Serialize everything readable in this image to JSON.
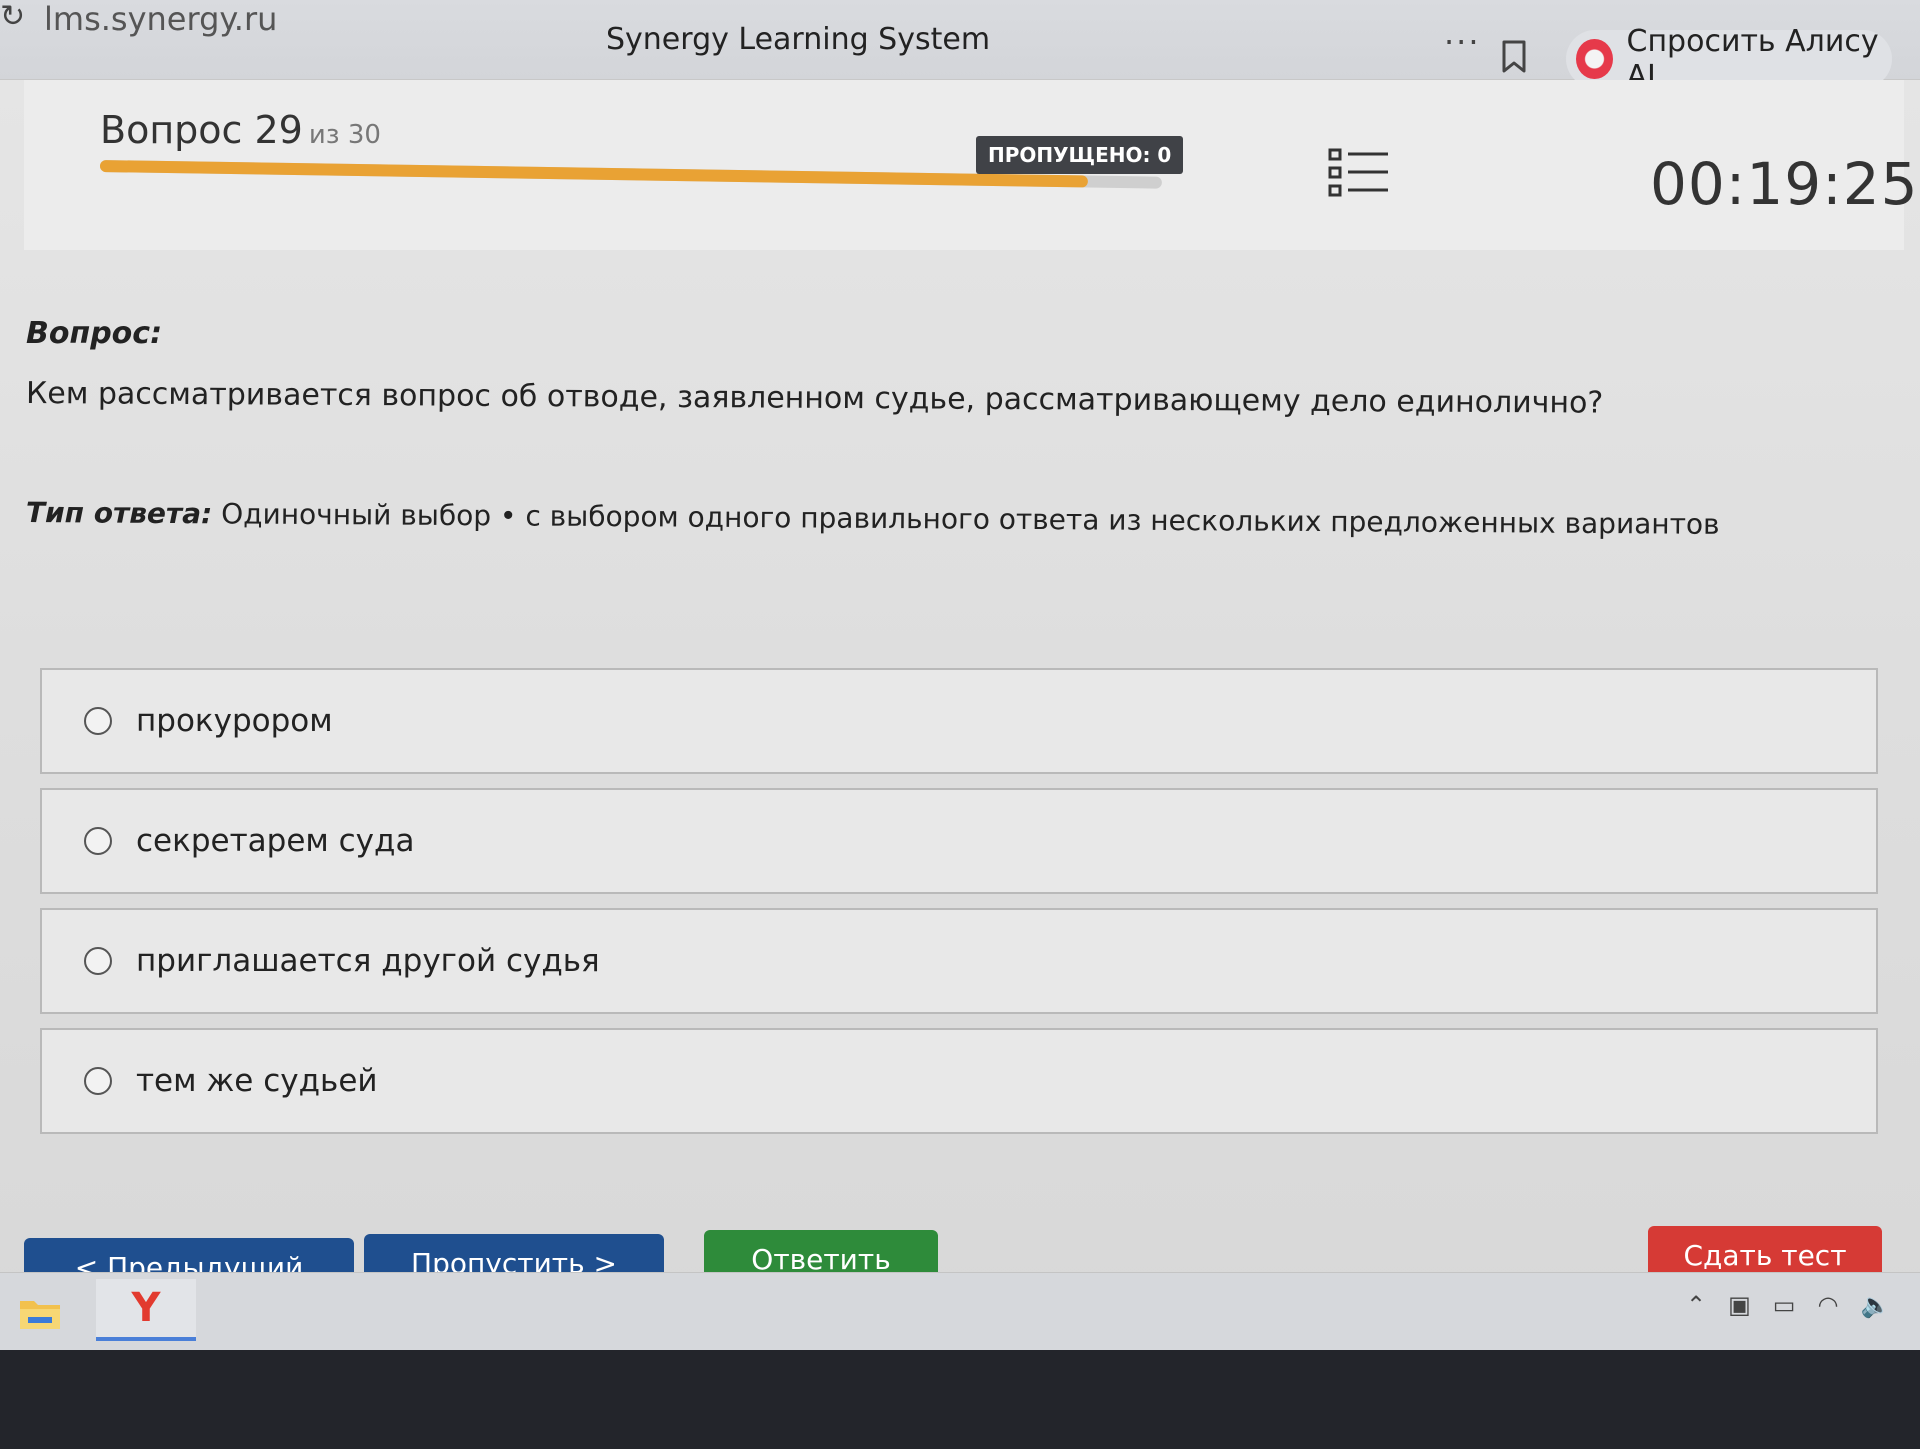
{
  "browser": {
    "url": "lms.synergy.ru",
    "title": "Synergy Learning System",
    "alice_label": "Спросить Алису AI"
  },
  "header": {
    "question_label": "Вопрос 29",
    "of_label": "из 30",
    "progress_fraction": 0.93,
    "skipped_badge": "ПРОПУЩЕНО: 0",
    "timer": "00:19:25"
  },
  "question": {
    "heading": "Вопрос:",
    "text": "Кем рассматривается вопрос об отводе, заявленном судье, рассматривающему дело единолично?",
    "answer_type_key": "Тип ответа:",
    "answer_type_value": " Одиночный выбор • с выбором одного правильного ответа из нескольких предложенных вариантов"
  },
  "options": [
    {
      "label": "прокурором"
    },
    {
      "label": "секретарем суда"
    },
    {
      "label": "приглашается другой судья"
    },
    {
      "label": "тем же судьей"
    }
  ],
  "buttons": {
    "prev": "< Предыдущий",
    "skip": "Пропустить >",
    "answer": "Ответить",
    "finish": "Сдать тест"
  },
  "taskbar": {
    "yandex_glyph": "Y"
  },
  "colors": {
    "progress": "#e9a234",
    "nav_blue": "#1f4f8f",
    "answer_green": "#2e8b3a",
    "finish_red": "#d63a35"
  }
}
